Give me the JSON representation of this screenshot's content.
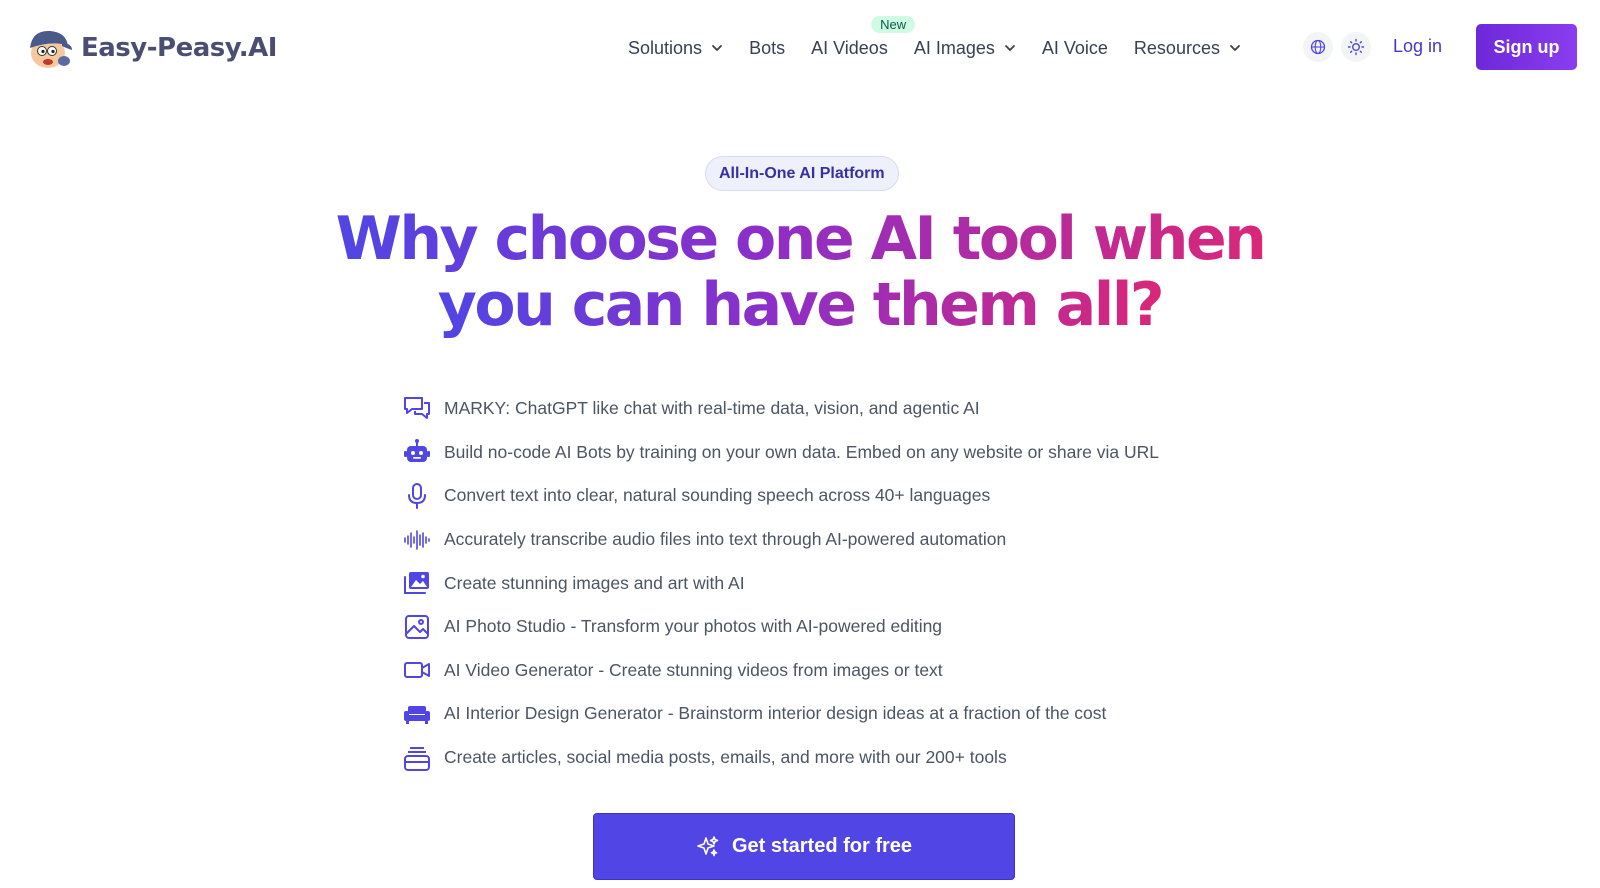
{
  "header": {
    "brand": "Easy-Peasy.AI",
    "nav": [
      {
        "label": "Solutions",
        "dropdown": true
      },
      {
        "label": "Bots",
        "dropdown": false
      },
      {
        "label": "AI Videos",
        "dropdown": false,
        "badge": "New"
      },
      {
        "label": "AI Images",
        "dropdown": true
      },
      {
        "label": "AI Voice",
        "dropdown": false
      },
      {
        "label": "Resources",
        "dropdown": true
      }
    ],
    "language_icon": "globe-icon",
    "theme_icon": "sun-icon",
    "login_label": "Log in",
    "signup_label": "Sign up"
  },
  "hero": {
    "pill": "All-In-One AI Platform",
    "headline_line1": "Why choose one AI tool when",
    "headline_line2": "you can have them all?",
    "features": [
      {
        "icon": "chat-bubbles-icon",
        "text": "MARKY: ChatGPT like chat with real-time data, vision, and agentic AI"
      },
      {
        "icon": "robot-icon",
        "text": "Build no-code AI Bots by training on your own data. Embed on any website or share via URL"
      },
      {
        "icon": "microphone-icon",
        "text": "Convert text into clear, natural sounding speech across 40+ languages"
      },
      {
        "icon": "waveform-icon",
        "text": "Accurately transcribe audio files into text through AI-powered automation"
      },
      {
        "icon": "image-stack-icon",
        "text": "Create stunning images and art with AI"
      },
      {
        "icon": "photo-icon",
        "text": "AI Photo Studio - Transform your photos with AI-powered editing"
      },
      {
        "icon": "video-camera-icon",
        "text": "AI Video Generator - Create stunning videos from images or text"
      },
      {
        "icon": "sofa-icon",
        "text": "AI Interior Design Generator - Brainstorm interior design ideas at a fraction of the cost"
      },
      {
        "icon": "stack-icon",
        "text": "Create articles, social media posts, emails, and more with our 200+ tools"
      }
    ],
    "cta_label": "Get started for free"
  },
  "colors": {
    "brand_purple": "#7c3aed",
    "indigo": "#5245e5",
    "icon_indigo": "#4f46e5",
    "gradient": [
      "#4f46e5",
      "#8b2fc9",
      "#db2777"
    ]
  }
}
